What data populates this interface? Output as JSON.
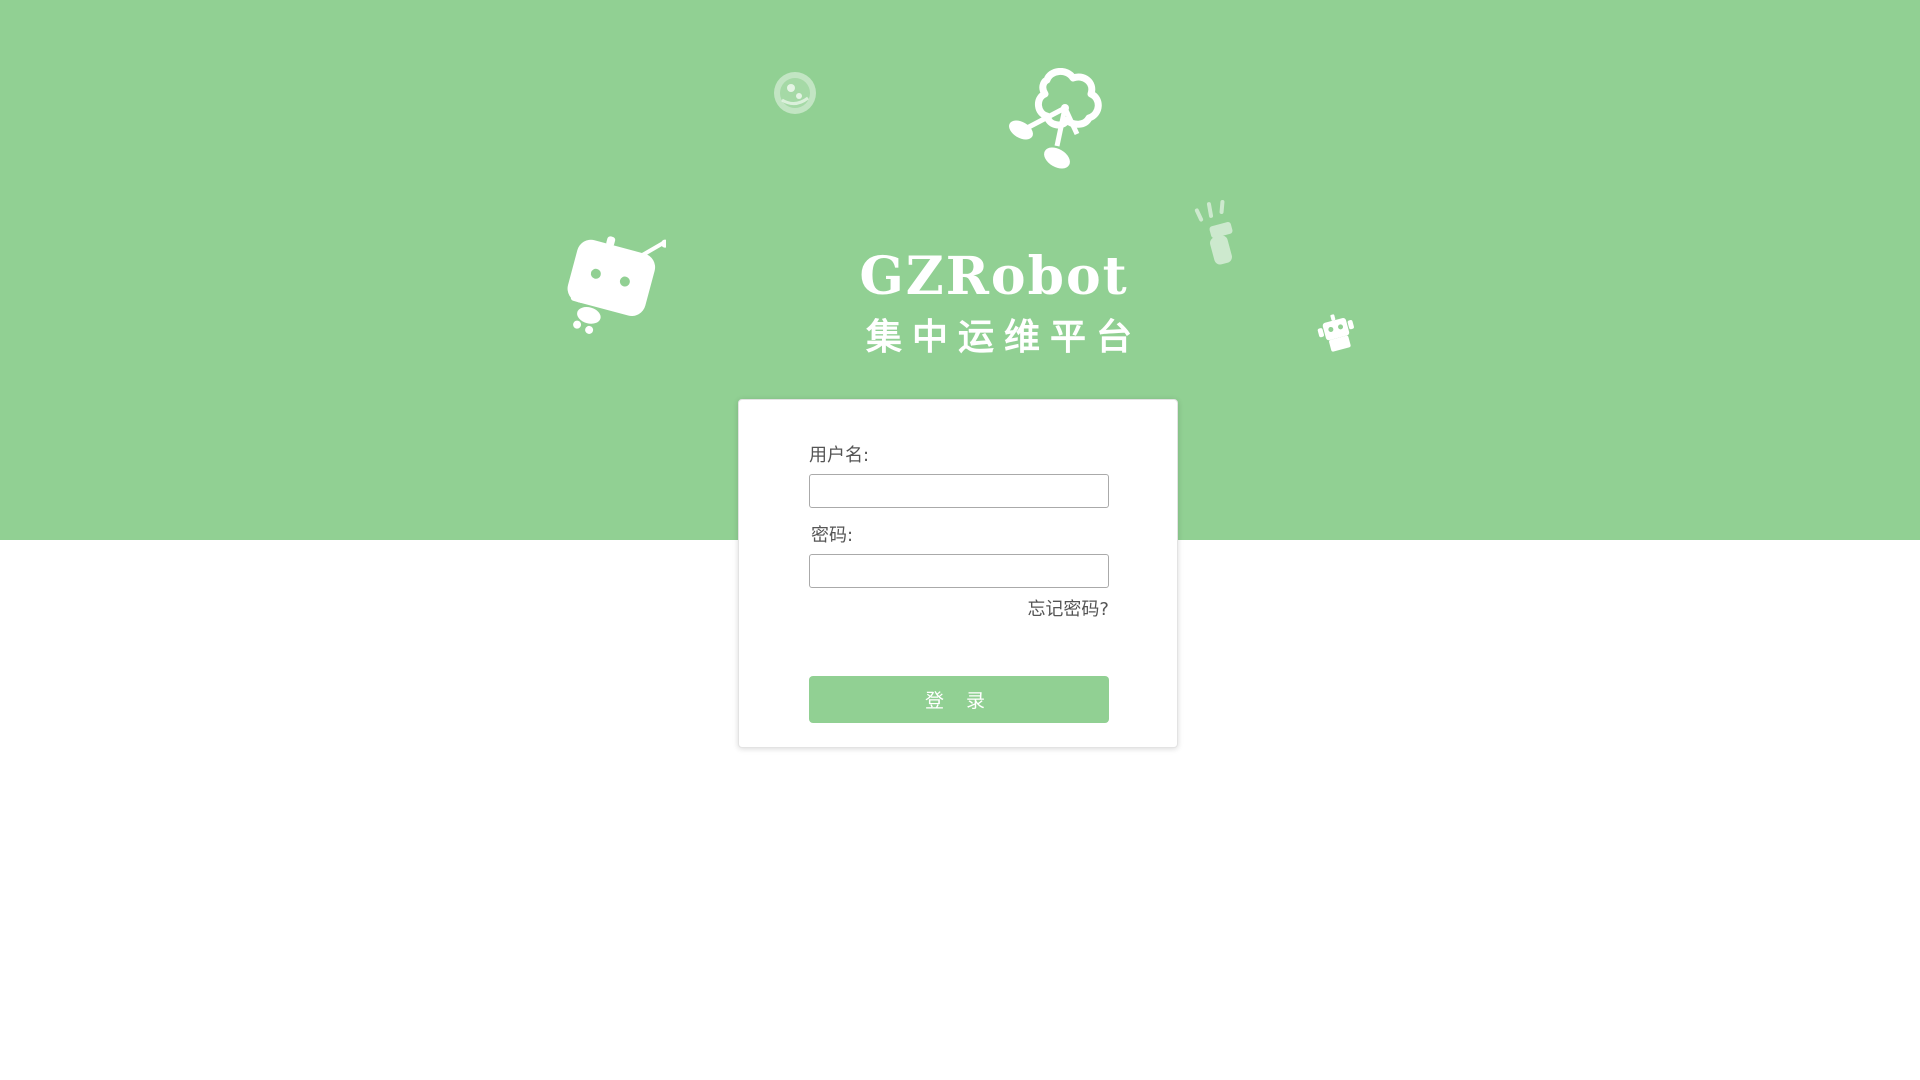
{
  "banner": {
    "title": "GZRobot",
    "subtitle": "集中运维平台",
    "background_color": "#91d093",
    "decorations": [
      "planet-icon",
      "cloud-network-icon",
      "robot-head-icon",
      "flashlight-icon",
      "small-robot-icon"
    ]
  },
  "login": {
    "username_label": "用户名:",
    "username_value": "",
    "password_label": "密码:",
    "password_value": "",
    "forgot_password": "忘记密码?",
    "submit_label": "登 录",
    "accent_color": "#91d093"
  }
}
